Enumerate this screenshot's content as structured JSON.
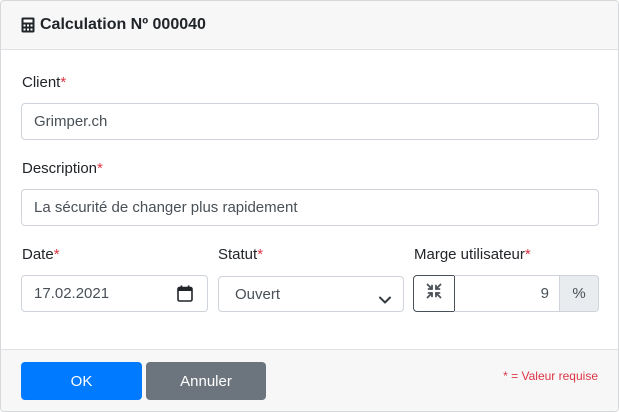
{
  "header": {
    "icon": "calculator-icon",
    "title": "Calculation Nº 000040"
  },
  "form": {
    "client": {
      "label": "Client",
      "required_mark": "*",
      "value": "Grimper.ch"
    },
    "description": {
      "label": "Description",
      "required_mark": "*",
      "value": "La sécurité de changer plus rapidement"
    },
    "date": {
      "label": "Date",
      "required_mark": "*",
      "value": "17.02.2021",
      "icon": "calendar-icon"
    },
    "status": {
      "label": "Statut",
      "required_mark": "*",
      "value": "Ouvert",
      "icon": "chevron-down-icon"
    },
    "margin": {
      "label": "Marge utilisateur",
      "required_mark": "*",
      "value": "9",
      "unit": "%",
      "icon": "compress-icon"
    }
  },
  "footer": {
    "ok_label": "OK",
    "cancel_label": "Annuler",
    "required_note": "* = Valeur requise"
  },
  "colors": {
    "primary": "#007bff",
    "secondary": "#6c757d",
    "required": "#dc3545"
  }
}
